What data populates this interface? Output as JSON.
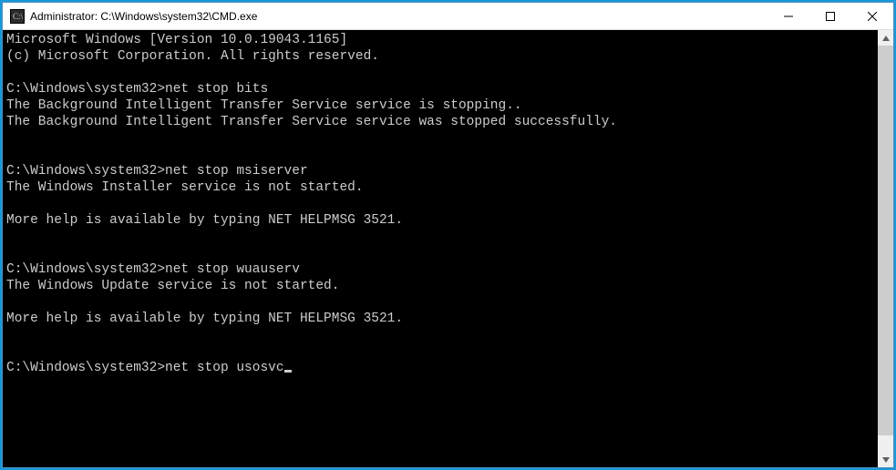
{
  "titlebar": {
    "title": "Administrator: C:\\Windows\\system32\\CMD.exe"
  },
  "console": {
    "lines": [
      "Microsoft Windows [Version 10.0.19043.1165]",
      "(c) Microsoft Corporation. All rights reserved.",
      "",
      "C:\\Windows\\system32>net stop bits",
      "The Background Intelligent Transfer Service service is stopping..",
      "The Background Intelligent Transfer Service service was stopped successfully.",
      "",
      "",
      "C:\\Windows\\system32>net stop msiserver",
      "The Windows Installer service is not started.",
      "",
      "More help is available by typing NET HELPMSG 3521.",
      "",
      "",
      "C:\\Windows\\system32>net stop wuauserv",
      "The Windows Update service is not started.",
      "",
      "More help is available by typing NET HELPMSG 3521.",
      "",
      ""
    ],
    "current_prompt": "C:\\Windows\\system32>",
    "current_input": "net stop usosvc"
  },
  "scrollbar": {
    "thumb_top_pct": 0,
    "thumb_height_pct": 96
  }
}
